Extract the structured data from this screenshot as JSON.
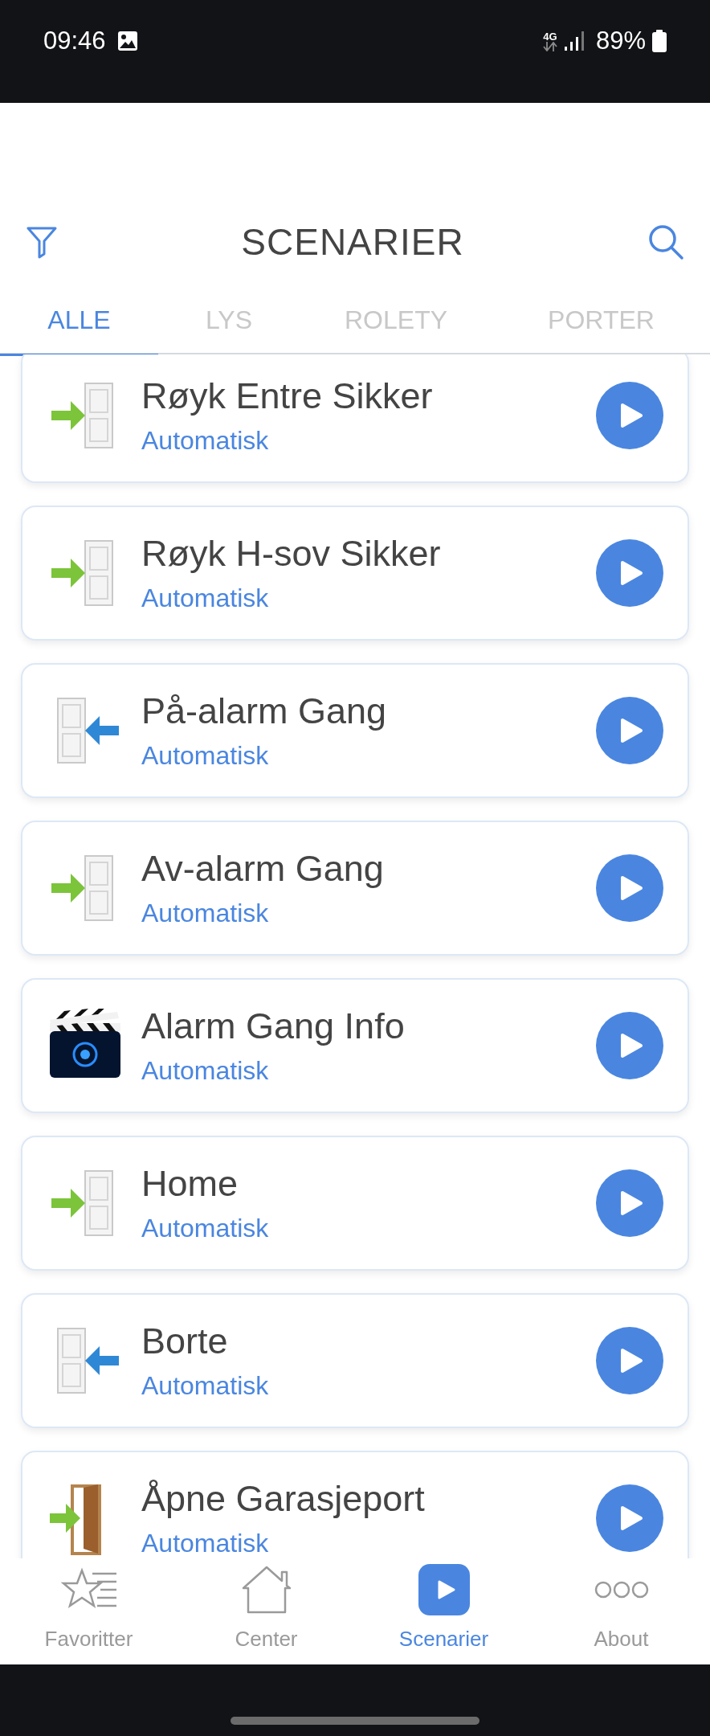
{
  "status_bar": {
    "time": "09:46",
    "network": "4G",
    "battery": "89%"
  },
  "header": {
    "title": "SCENARIER"
  },
  "tabs": [
    {
      "label": "ALLE",
      "selected": true
    },
    {
      "label": "LYS",
      "selected": false
    },
    {
      "label": "ROLETY",
      "selected": false
    },
    {
      "label": "PORTER",
      "selected": false
    }
  ],
  "scenes": [
    {
      "name": "Røyk Entre Sikker",
      "mode": "Automatisk",
      "kind": "enter"
    },
    {
      "name": "Røyk H-sov Sikker",
      "mode": "Automatisk",
      "kind": "enter"
    },
    {
      "name": "På-alarm Gang",
      "mode": "Automatisk",
      "kind": "exit"
    },
    {
      "name": "Av-alarm Gang",
      "mode": "Automatisk",
      "kind": "enter"
    },
    {
      "name": "Alarm Gang Info",
      "mode": "Automatisk",
      "kind": "video"
    },
    {
      "name": "Home",
      "mode": "Automatisk",
      "kind": "enter"
    },
    {
      "name": "Borte",
      "mode": "Automatisk",
      "kind": "exit"
    },
    {
      "name": "Åpne Garasjeport",
      "mode": "Automatisk",
      "kind": "garage"
    }
  ],
  "nav": [
    {
      "label": "Favoritter",
      "selected": false
    },
    {
      "label": "Center",
      "selected": false
    },
    {
      "label": "Scenarier",
      "selected": true
    },
    {
      "label": "About",
      "selected": false
    }
  ]
}
